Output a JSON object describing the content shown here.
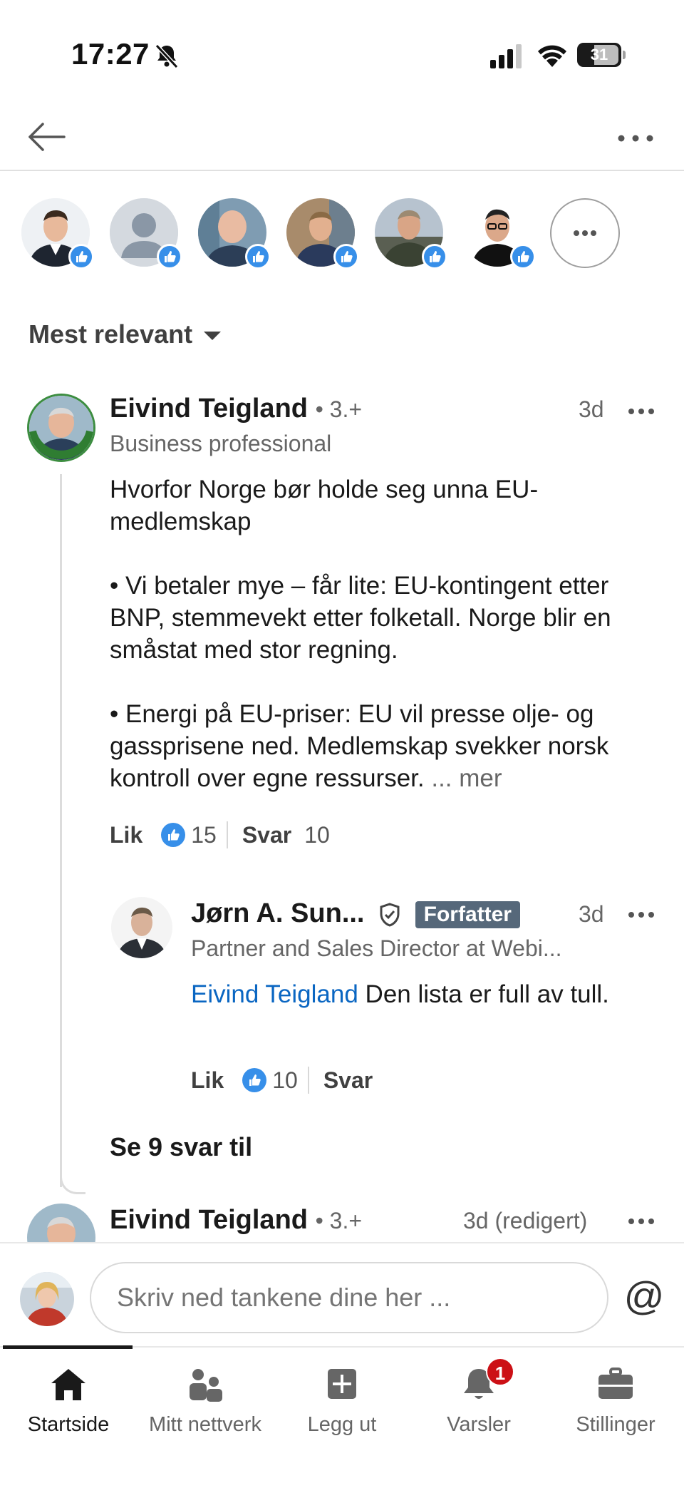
{
  "status_bar": {
    "time": "17:27",
    "battery": "31"
  },
  "reactors": [
    {
      "icon": "avatar-man-dark-suit"
    },
    {
      "icon": "avatar-placeholder"
    },
    {
      "icon": "avatar-bald-man"
    },
    {
      "icon": "avatar-man-blue-suit"
    },
    {
      "icon": "avatar-man-speaking"
    },
    {
      "icon": "avatar-man-glasses"
    }
  ],
  "sort": {
    "label": "Mest relevant"
  },
  "comment1": {
    "name": "Eivind Teigland",
    "degree": "• 3.+",
    "time": "3d",
    "headline": "Business professional",
    "paragraphs": [
      "Hvorfor Norge bør holde seg unna EU-medlemskap",
      "• Vi betaler mye – får lite: EU-kontingent etter BNP, stemmevekt etter folketall. Norge blir en småstat med stor regning.",
      "• Energi på EU-priser: EU vil presse olje- og gassprisene ned. Medlemskap svekker norsk kontroll over egne ressurser."
    ],
    "see_more": "... mer",
    "like_label": "Lik",
    "like_count": "15",
    "reply_label": "Svar",
    "reply_count": "10"
  },
  "reply1": {
    "name": "Jørn A. Sun...",
    "badge": "Forfatter",
    "time": "3d",
    "headline": "Partner and Sales Director at Webi...",
    "mention": "Eivind Teigland",
    "text": "Den lista er full av tull.",
    "like_label": "Lik",
    "like_count": "10",
    "reply_label": "Svar"
  },
  "see_more_replies": "Se 9 svar til",
  "comment2": {
    "name": "Eivind Teigland",
    "degree": "• 3.+",
    "time": "3d (redigert)"
  },
  "composer": {
    "placeholder": "Skriv ned tankene dine her ...",
    "at_symbol": "@"
  },
  "bottom_nav": {
    "tabs": [
      {
        "label": "Startside",
        "icon": "home-icon",
        "active": true
      },
      {
        "label": "Mitt nettverk",
        "icon": "network-icon"
      },
      {
        "label": "Legg ut",
        "icon": "post-icon"
      },
      {
        "label": "Varsler",
        "icon": "bell-icon",
        "badge": "1"
      },
      {
        "label": "Stillinger",
        "icon": "briefcase-icon"
      }
    ]
  },
  "colors": {
    "link": "#0a66c2",
    "like_blue": "#378fe9",
    "author_badge": "#56687a",
    "notif_red": "#cc1016"
  }
}
